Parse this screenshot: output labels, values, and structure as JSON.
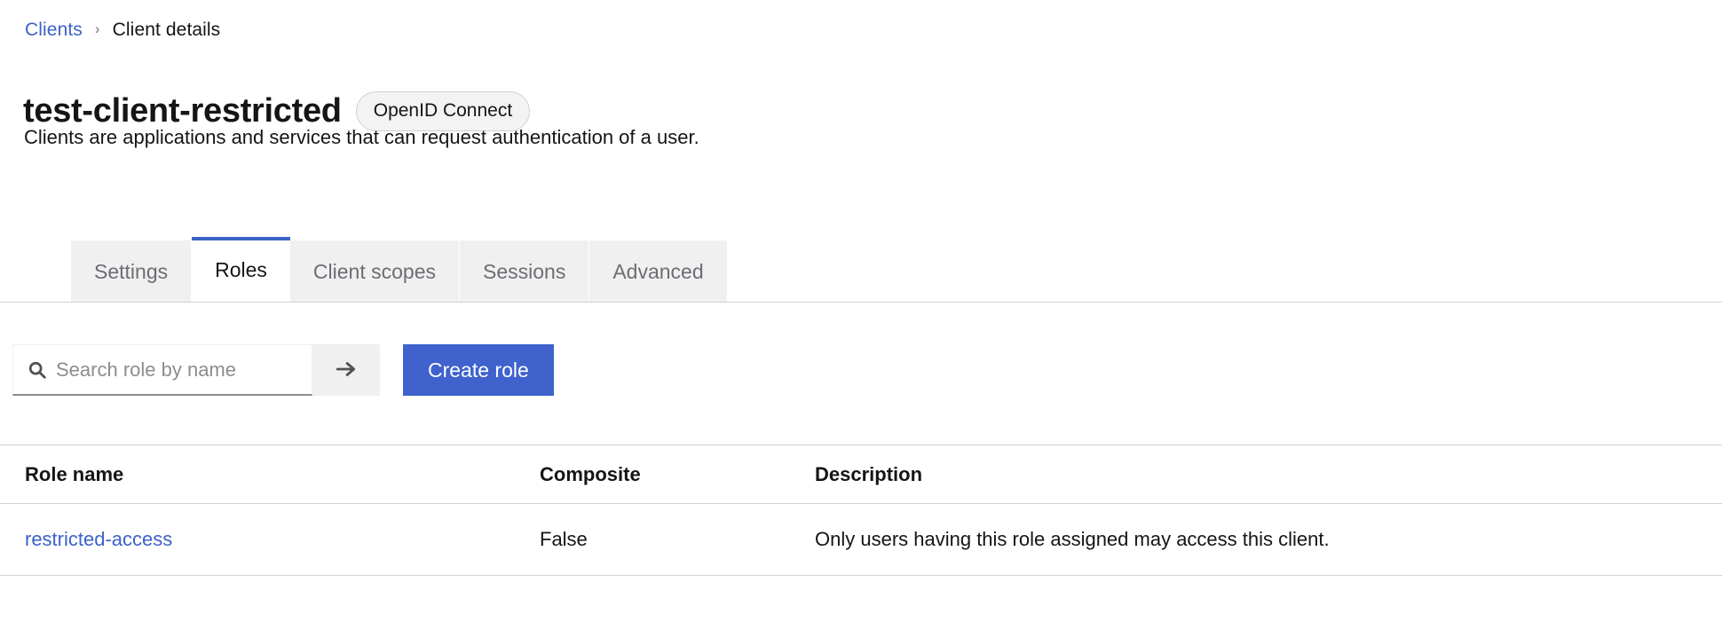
{
  "breadcrumb": {
    "parent_label": "Clients",
    "separator": "›",
    "current_label": "Client details"
  },
  "header": {
    "title": "test-client-restricted",
    "type_badge": "OpenID Connect",
    "subtitle": "Clients are applications and services that can request authentication of a user."
  },
  "tabs": [
    {
      "label": "Settings",
      "active": false
    },
    {
      "label": "Roles",
      "active": true
    },
    {
      "label": "Client scopes",
      "active": false
    },
    {
      "label": "Sessions",
      "active": false
    },
    {
      "label": "Advanced",
      "active": false
    }
  ],
  "toolbar": {
    "search_value": "",
    "search_placeholder": "Search role by name",
    "search_icon": "search-icon",
    "search_submit_icon": "arrow-right-icon",
    "create_label": "Create role"
  },
  "table": {
    "columns": [
      "Role name",
      "Composite",
      "Description"
    ],
    "rows": [
      {
        "role_name": "restricted-access",
        "composite": "False",
        "description": "Only users having this role assigned may access this client."
      }
    ]
  },
  "colors": {
    "link": "#3d62c7",
    "primary_button": "#3f62cd",
    "active_tab_border": "#3d62c7",
    "tab_inactive_bg": "#f0f0f0",
    "badge_bg": "#f3f3f3",
    "divider": "#d2d2d2",
    "text": "#151515",
    "muted_text": "#6a6e73"
  }
}
